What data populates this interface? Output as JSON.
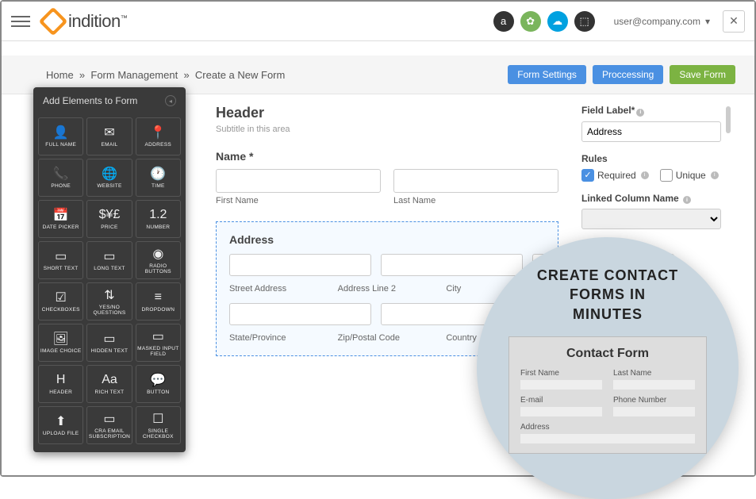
{
  "brand": {
    "name": "indition",
    "tm": "™"
  },
  "user": {
    "email": "user@company.com"
  },
  "topbar_apps": [
    "amazon",
    "shopify",
    "salesforce",
    "other"
  ],
  "breadcrumb": {
    "home": "Home",
    "sep": "»",
    "l1": "Form Management",
    "l2": "Create a New Form"
  },
  "actions": {
    "settings": "Form Settings",
    "processing": "Proccessing",
    "save": "Save Form"
  },
  "panel": {
    "title": "Add Elements to Form",
    "items": [
      {
        "icon": "👤",
        "label": "FULL NAME"
      },
      {
        "icon": "✉",
        "label": "EMAIL"
      },
      {
        "icon": "📍",
        "label": "ADDRESS"
      },
      {
        "icon": "📞",
        "label": "PHONE"
      },
      {
        "icon": "🌐",
        "label": "WEBSITE"
      },
      {
        "icon": "🕐",
        "label": "TIME"
      },
      {
        "icon": "📅",
        "label": "DATE PICKER"
      },
      {
        "icon": "$¥£",
        "label": "PRICE"
      },
      {
        "icon": "1.2",
        "label": "NUMBER"
      },
      {
        "icon": "▭",
        "label": "SHORT TEXT"
      },
      {
        "icon": "▭",
        "label": "LONG TEXT"
      },
      {
        "icon": "◉",
        "label": "RADIO BUTTONS"
      },
      {
        "icon": "☑",
        "label": "CHECKBOXES"
      },
      {
        "icon": "⇅",
        "label": "YES/NO QUESTIONS"
      },
      {
        "icon": "≡",
        "label": "DROPDOWN"
      },
      {
        "icon": "🖼",
        "label": "IMAGE CHOICE"
      },
      {
        "icon": "▭",
        "label": "HIDDEN TEXT"
      },
      {
        "icon": "▭",
        "label": "MASKED INPUT FIELD"
      },
      {
        "icon": "H",
        "label": "HEADER"
      },
      {
        "icon": "Aa",
        "label": "RICH TEXT"
      },
      {
        "icon": "💬",
        "label": "BUTTON"
      },
      {
        "icon": "⬆",
        "label": "UPLOAD FILE"
      },
      {
        "icon": "▭",
        "label": "CRA EMAIL SUBSCRIPTION"
      },
      {
        "icon": "☐",
        "label": "SINGLE CHECKBOX"
      }
    ]
  },
  "canvas": {
    "header": {
      "title": "Header",
      "sub": "Subtitle in this area"
    },
    "name": {
      "label": "Name *",
      "first": "First Name",
      "last": "Last Name"
    },
    "address": {
      "label": "Address",
      "row1": [
        "Street Address",
        "Address Line 2",
        "City"
      ],
      "row2": [
        "State/Province",
        "Zip/Postal Code",
        "Country"
      ]
    }
  },
  "props": {
    "fieldLabel": {
      "label": "Field Label*",
      "value": "Address"
    },
    "rules": {
      "label": "Rules",
      "required": "Required",
      "unique": "Unique"
    },
    "linked": {
      "label": "Linked Column Name"
    }
  },
  "promo": {
    "title_l1": "CREATE CONTACT",
    "title_l2": "FORMS IN",
    "title_l3": "MINUTES",
    "card_title": "Contact Form",
    "fields": {
      "first": "First Name",
      "last": "Last Name",
      "email": "E-mail",
      "phone": "Phone Number",
      "address": "Address"
    }
  }
}
